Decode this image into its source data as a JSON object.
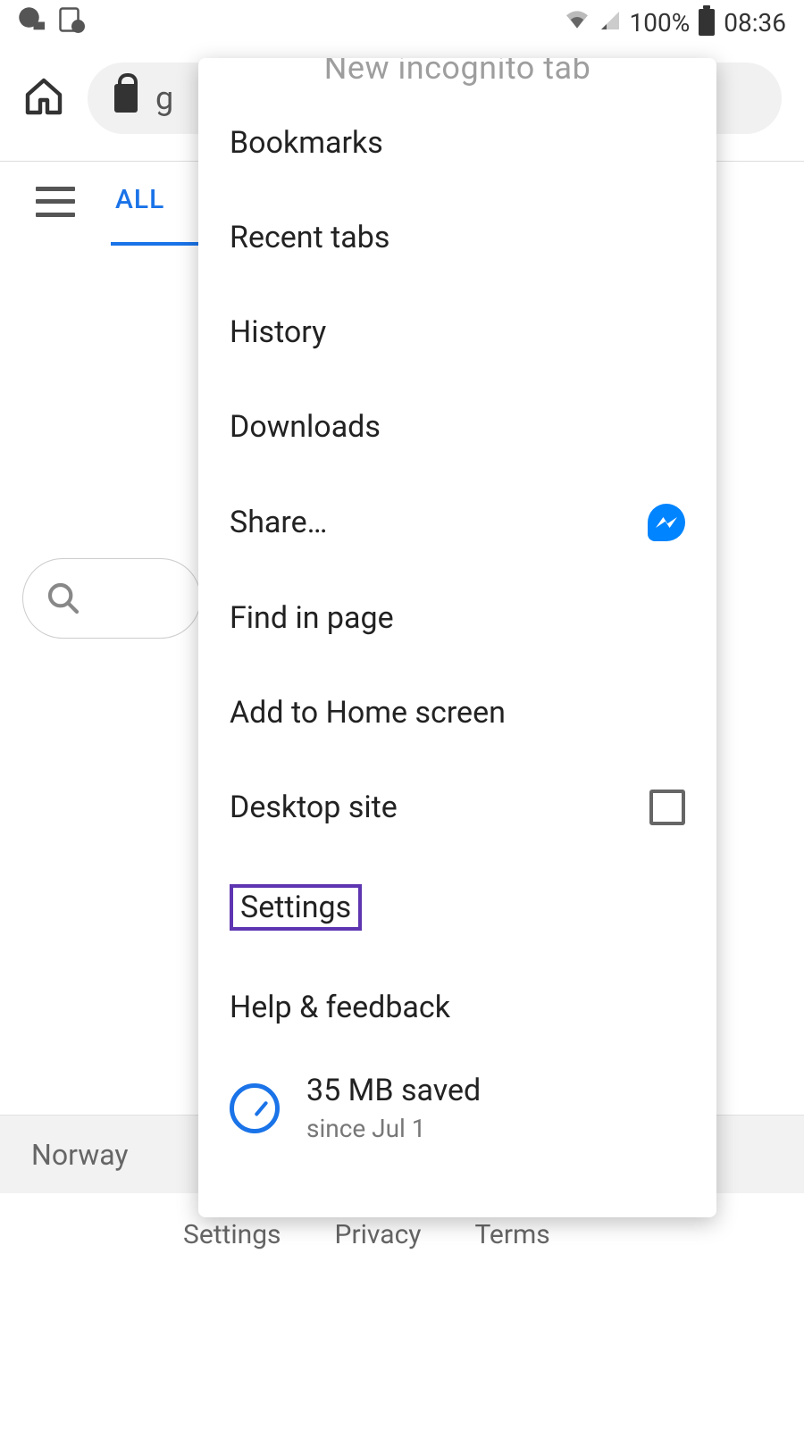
{
  "status_bar": {
    "battery_pct": "100%",
    "time": "08:36"
  },
  "browser": {
    "url_fragment": "g"
  },
  "page": {
    "tab_all": "ALL",
    "location": "Norway",
    "footer_links": [
      "Settings",
      "Privacy",
      "Terms"
    ]
  },
  "menu": {
    "partial_top": "New incognito tab",
    "items": [
      {
        "label": "Bookmarks"
      },
      {
        "label": "Recent tabs"
      },
      {
        "label": "History"
      },
      {
        "label": "Downloads"
      },
      {
        "label": "Share…",
        "icon": "messenger"
      },
      {
        "label": "Find in page"
      },
      {
        "label": "Add to Home screen"
      },
      {
        "label": "Desktop site",
        "checkbox": true
      },
      {
        "label": "Settings",
        "highlighted": true
      },
      {
        "label": "Help & feedback"
      }
    ],
    "data_saved": {
      "title": "35 MB saved",
      "subtitle": "since Jul 1"
    }
  }
}
